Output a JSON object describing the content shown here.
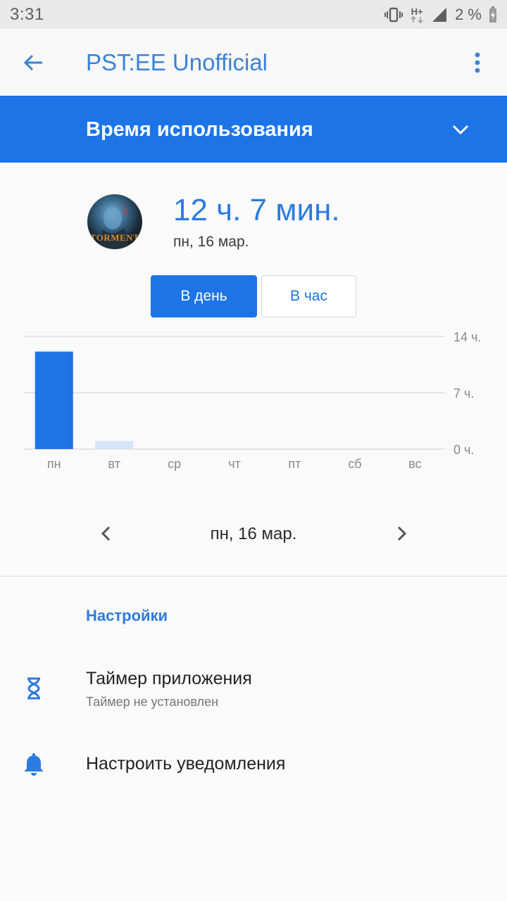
{
  "status_bar": {
    "time": "3:31",
    "network": "H+",
    "battery": "2 %"
  },
  "app_bar": {
    "title": "PST:EE Unofficial",
    "back_icon": "arrow-left-icon",
    "menu_icon": "more-vert-icon"
  },
  "section": {
    "title": "Время использования",
    "expand_icon": "chevron-down-icon"
  },
  "app": {
    "icon_text": "TORMENT",
    "total_usage": "12 ч. 7 мин.",
    "date": "пн, 16 мар."
  },
  "toggle": {
    "day": "В день",
    "hour": "В час",
    "selected": "day"
  },
  "chart_data": {
    "type": "bar",
    "categories": [
      "пн",
      "вт",
      "ср",
      "чт",
      "пт",
      "сб",
      "вс"
    ],
    "values": [
      12.12,
      1.0,
      0,
      0,
      0,
      0,
      0
    ],
    "highlighted": "пн",
    "ylim": [
      0,
      14
    ],
    "y_ticks": [
      {
        "value": 14,
        "label": "14 ч."
      },
      {
        "value": 7,
        "label": "7 ч."
      },
      {
        "value": 0,
        "label": "0 ч."
      }
    ],
    "grid": true,
    "colors": {
      "active": "#1c74e7",
      "inactive": "#d6e4f8"
    }
  },
  "date_nav": {
    "current": "пн, 16 мар.",
    "prev_icon": "chevron-left-icon",
    "next_icon": "chevron-right-icon"
  },
  "settings": {
    "header": "Настройки",
    "items": [
      {
        "title": "Таймер приложения",
        "subtitle": "Таймер не установлен",
        "icon": "hourglass-icon"
      },
      {
        "title": "Настроить уведомления",
        "icon": "bell-icon"
      }
    ]
  },
  "colors": {
    "accent": "#1c74e7",
    "accent_text": "#2c7be0"
  }
}
